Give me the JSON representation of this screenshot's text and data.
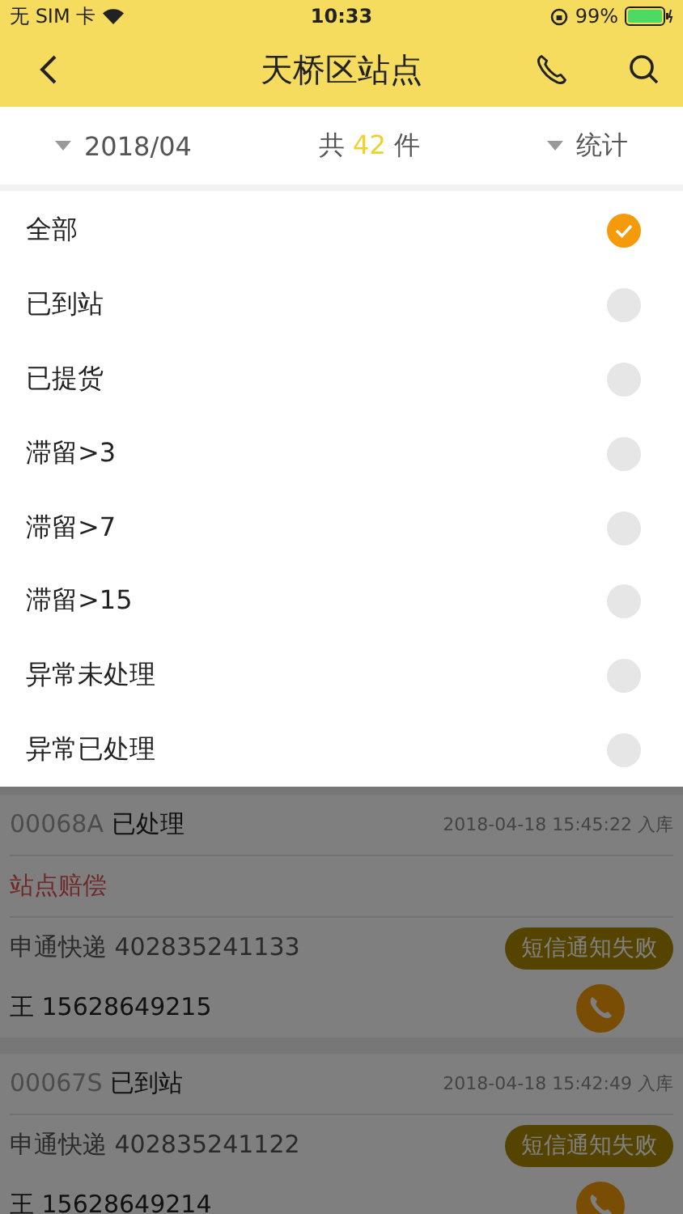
{
  "status_bar": {
    "carrier": "无 SIM 卡",
    "time": "10:33",
    "battery": "99%"
  },
  "nav": {
    "title": "天桥区站点"
  },
  "filter": {
    "month": "2018/04",
    "total_prefix": "共",
    "total_count": "42",
    "total_suffix": "件",
    "stats": "统计"
  },
  "options": [
    {
      "label": "全部",
      "selected": true
    },
    {
      "label": "已到站",
      "selected": false
    },
    {
      "label": "已提货",
      "selected": false
    },
    {
      "label": "滞留>3",
      "selected": false
    },
    {
      "label": "滞留>7",
      "selected": false
    },
    {
      "label": "滞留>15",
      "selected": false
    },
    {
      "label": "异常未处理",
      "selected": false
    },
    {
      "label": "异常已处理",
      "selected": false
    }
  ],
  "parcels": [
    {
      "code": "00068A",
      "status": "已处理",
      "time": "2018-04-18 15:45:22 入库",
      "note": "站点赔偿",
      "tracking": "申通快递 402835241133",
      "sms_status": "短信通知失败",
      "contact": "王 15628649215"
    },
    {
      "code": "00067S",
      "status": "已到站",
      "time": "2018-04-18 15:42:49 入库",
      "tracking": "申通快递 402835241122",
      "sms_status": "短信通知失败",
      "contact": "王 15628649214"
    }
  ]
}
